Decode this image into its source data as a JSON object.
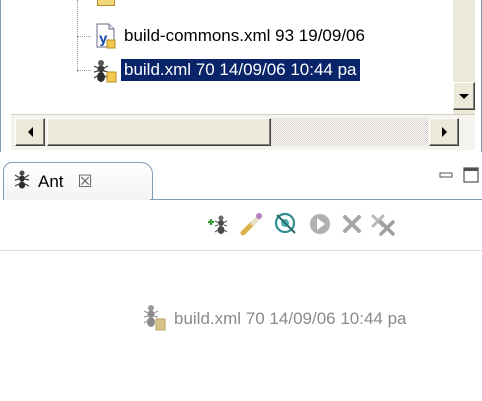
{
  "navigator": {
    "items": [
      {
        "label": "build-commons.xml 93  19/09/06",
        "icon": "xml-file-icon",
        "selected": false
      },
      {
        "label": "build.xml 70  14/09/06 10:44  pa",
        "icon": "ant-buildfile-icon",
        "selected": true
      }
    ]
  },
  "ant_view": {
    "tab_label": "Ant",
    "tab_close": "☒",
    "toolbar_icons": [
      "add-buildfiles-icon",
      "search-buildfiles-icon",
      "hide-internal-targets-icon",
      "run-target-icon",
      "remove-icon",
      "remove-all-icon"
    ],
    "buildfile_label": "build.xml 70  14/09/06 10:44  pa"
  },
  "colors": {
    "selection_bg": "#0a246a",
    "selection_fg": "#ffffff",
    "tab_border": "#7f9db9",
    "disabled_text": "#8a8a8a"
  }
}
